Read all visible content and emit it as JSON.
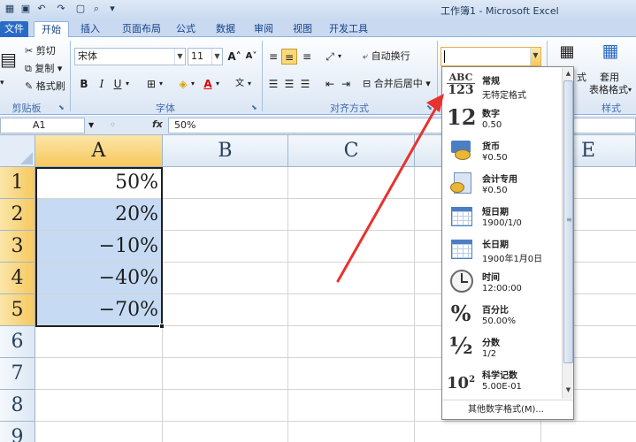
{
  "window": {
    "title": "工作簿1 - Microsoft Excel"
  },
  "tabs": [
    "文件",
    "开始",
    "插入",
    "页面布局",
    "公式",
    "数据",
    "审阅",
    "视图",
    "开发工具"
  ],
  "active_tab": "开始",
  "clipboard": {
    "cut": "剪切",
    "copy": "复制",
    "format_painter": "格式刷",
    "label": "剪贴板"
  },
  "font": {
    "name": "宋体",
    "size": "11",
    "label": "字体",
    "bold": "B",
    "italic": "I",
    "underline": "U",
    "grow": "A˄",
    "shrink": "A˅"
  },
  "alignment": {
    "wrap": "自动换行",
    "merge": "合并后居中",
    "label": "对齐方式"
  },
  "number_format": {
    "value": ""
  },
  "styles": {
    "table_format_1": "套用",
    "table_format_2": "表格格式",
    "label": "样式",
    "partial": "式"
  },
  "formula_bar": {
    "name_box": "A1",
    "fx": "fx",
    "value": "50%"
  },
  "columns": [
    "A",
    "B",
    "C",
    "D",
    "E"
  ],
  "rows": [
    "1",
    "2",
    "3",
    "4",
    "5",
    "6",
    "7",
    "8",
    "9"
  ],
  "cells": [
    "50%",
    "20%",
    "−10%",
    "−40%",
    "−70%"
  ],
  "dropdown": {
    "items": [
      {
        "icon": "ABC 123",
        "name": "常规",
        "sample": "无特定格式"
      },
      {
        "icon": "12",
        "name": "数字",
        "sample": "0.50"
      },
      {
        "icon": "coin",
        "name": "货币",
        "sample": "¥0.50"
      },
      {
        "icon": "ledger",
        "name": "会计专用",
        "sample": " ¥0.50"
      },
      {
        "icon": "calendar",
        "name": "短日期",
        "sample": "1900/1/0"
      },
      {
        "icon": "calendar",
        "name": "长日期",
        "sample": "1900年1月0日"
      },
      {
        "icon": "clock",
        "name": "时间",
        "sample": "12:00:00"
      },
      {
        "icon": "%",
        "name": "百分比",
        "sample": "50.00%"
      },
      {
        "icon": "½",
        "name": "分数",
        "sample": "1/2"
      },
      {
        "icon": "10²",
        "name": "科学记数",
        "sample": "5.00E-01"
      }
    ],
    "more": "其他数字格式(M)..."
  },
  "colors": {
    "accent": "#2a6ac7",
    "selection": "#c6dbf3",
    "header_selected": "#f7c85e",
    "arrow": "#e8322f"
  }
}
